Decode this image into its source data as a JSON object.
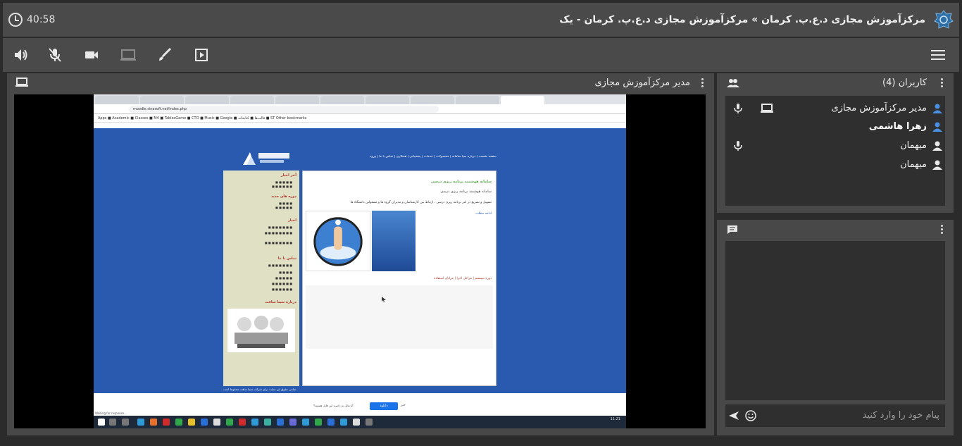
{
  "topbar": {
    "timer": "40:58",
    "title": "مرکزآموزش مجازی د.ع.پ. کرمان » مرکزآموزش مجازی د.ع.پ. کرمان - یک"
  },
  "toolbar": {
    "icons": [
      "speaker-icon",
      "mic-muted-icon",
      "camera-icon",
      "screen-share-icon",
      "brush-icon",
      "play-icon",
      "menu-icon"
    ]
  },
  "share": {
    "title": "مدیر مرکزآموزش مجازی"
  },
  "users": {
    "header": "کاربران (4)",
    "items": [
      {
        "name": "مدیر مرکزآموزش مجازی",
        "bold": false,
        "mic": true,
        "screen": true
      },
      {
        "name": "زهرا هاشمی",
        "bold": true,
        "mic": false,
        "screen": false
      },
      {
        "name": "میهمان",
        "bold": false,
        "mic": true,
        "screen": false
      },
      {
        "name": "میهمان",
        "bold": false,
        "mic": false,
        "screen": false
      }
    ]
  },
  "chat": {
    "placeholder": "پیام خود را وارد کنید"
  },
  "inner": {
    "bookmarks": "Apps  ■ Academic  ■ Classes  ■ M4  ■ TablesGame  ■ CTO  ■ Music  ■ Google  ■ قالب‌ها  ■ کتابخانه  ■ ST                                  Other bookmarks",
    "address": "moodle.sinasoft.net/index.php",
    "nav": "صفحه نخست | درباره سپا سامانه | محصولات | خدمات | پشتیبانی | همکاری | تماس با ما | ورود",
    "site_sub": "سامانه هوشمند برنامه ریزی درسی",
    "site_desc": "تسهیل و تسریع در امر برنامه ریزی درسی ، ارتباط بین کارشناسان و مدیران گروه ها و مسئولین دانشگاه ها",
    "site_link": "ادامه مطلب",
    "tabs_row": "دوره سیستم | مراحل اجرا | مزایای استفاده",
    "sidebar_heads": [
      "آخر اخبار",
      "دوره های جدید",
      "اخبار",
      "تماس با ما",
      "درباره سینا سافت"
    ],
    "download_text": "آیا مایل به ذخیره این فایل هستید؟",
    "download_btn": "دانلود",
    "download_no": "خیر",
    "footer": "تمامی حقوق این سایت برای شرکت سینا سافت محفوظ است",
    "status": "Waiting for response...",
    "clock": "11:21"
  }
}
